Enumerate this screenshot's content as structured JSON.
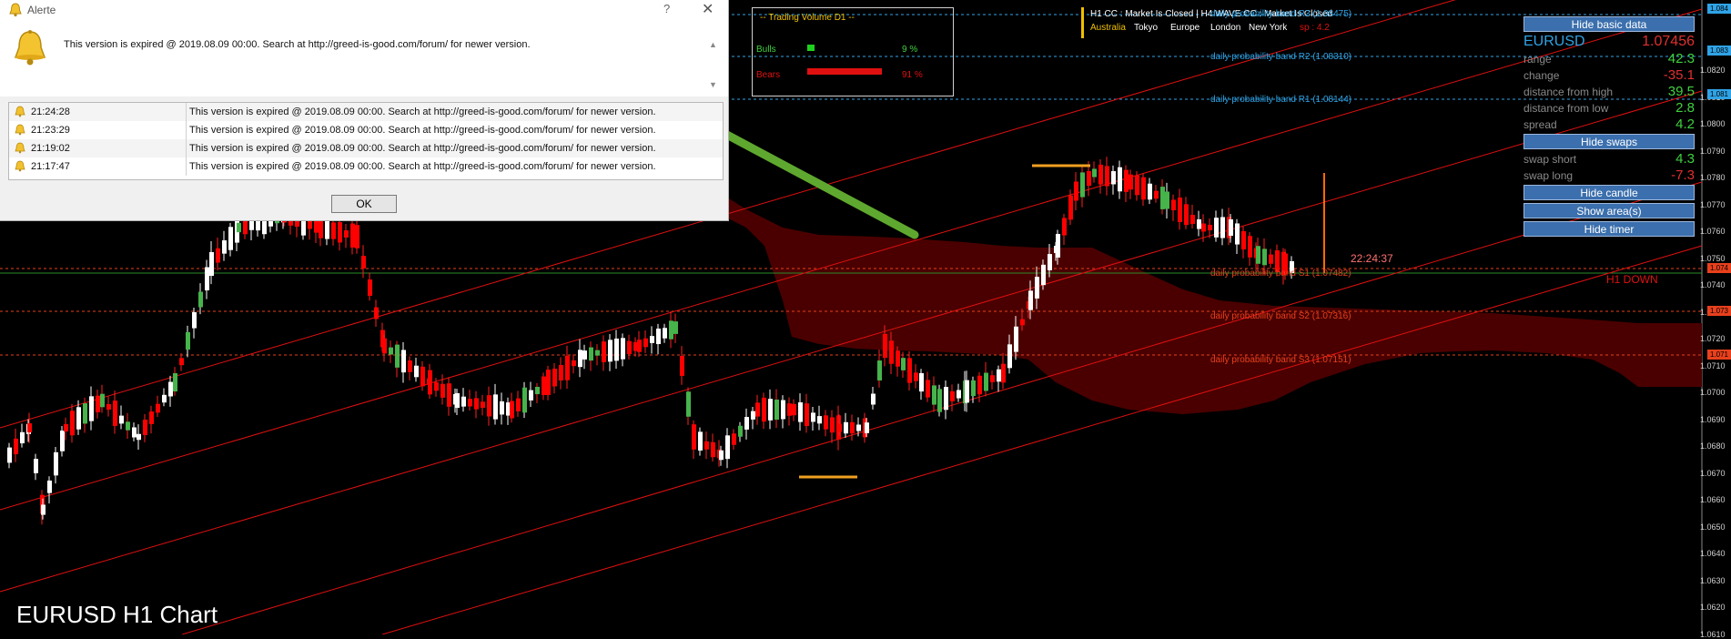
{
  "chart": {
    "title": "EURUSD H1 Chart",
    "timer": "22:24:37",
    "signal": "H1 DOWN"
  },
  "session_bar": {
    "status": "H1 CC : Market Is Closed  |  H4 WAVE CC : Market Is Closed",
    "cities": [
      "Australia",
      "Tokyo",
      "Europe",
      "London",
      "New York"
    ],
    "spread_label": "sp : 4.2"
  },
  "probability_bands": {
    "r3": "daily probability band R3 (1.08475)",
    "r2": "daily probability band R2 (1.08310)",
    "r1": "daily probability band R1 (1.08144)",
    "s1": "daily probability band S1 (1.07482)",
    "s2": "daily probability band S2 (1.07316)",
    "s3": "daily probability band S3 (1.07151)"
  },
  "volume_panel": {
    "title": "-- Trading Volume D1 --",
    "bulls_label": "Bulls",
    "bulls_value": "9 %",
    "bulls_pct": 9,
    "bears_label": "Bears",
    "bears_value": "91 %",
    "bears_pct": 91
  },
  "side_panel": {
    "hide_basic_data": "Hide basic data",
    "symbol": "EURUSD",
    "price": "1.07456",
    "range_label": "range",
    "range_value": "42.3",
    "change_label": "change",
    "change_value": "-35.1",
    "dist_high_label": "distance from high",
    "dist_high_value": "39.5",
    "dist_low_label": "distance from low",
    "dist_low_value": "2.8",
    "spread_label": "spread",
    "spread_value": "4.2",
    "hide_swaps": "Hide swaps",
    "swap_short_label": "swap short",
    "swap_short_value": "4.3",
    "swap_long_label": "swap long",
    "swap_long_value": "-7.3",
    "hide_candle": "Hide candle",
    "show_areas": "Show area(s)",
    "hide_timer": "Hide timer"
  },
  "price_axis": {
    "labels": [
      "1.0820",
      "1.0810",
      "1.0800",
      "1.0790",
      "1.0780",
      "1.0770",
      "1.0760",
      "1.0750",
      "1.0740",
      "1.0730",
      "1.0720",
      "1.0710",
      "1.0700",
      "1.0690",
      "1.0680",
      "1.0670",
      "1.0660",
      "1.0650",
      "1.0640",
      "1.0630",
      "1.0620",
      "1.0610"
    ],
    "tags": [
      "1.084",
      "1.083",
      "1.081",
      "1.074",
      "1.073",
      "1.071"
    ]
  },
  "dialog": {
    "title": "Alerte",
    "help": "?",
    "close": "✕",
    "message": "This version is expired @ 2019.08.09 00:00. Search at http://greed-is-good.com/forum/ for newer version.",
    "rows": [
      {
        "time": "21:24:28",
        "text": "This version is expired @ 2019.08.09 00:00. Search at http://greed-is-good.com/forum/ for newer version."
      },
      {
        "time": "21:23:29",
        "text": "This version is expired @ 2019.08.09 00:00. Search at http://greed-is-good.com/forum/ for newer version."
      },
      {
        "time": "21:19:02",
        "text": "This version is expired @ 2019.08.09 00:00. Search at http://greed-is-good.com/forum/ for newer version."
      },
      {
        "time": "21:17:47",
        "text": "This version is expired @ 2019.08.09 00:00. Search at http://greed-is-good.com/forum/ for newer version."
      }
    ],
    "ok": "OK"
  },
  "colors": {
    "bull_candle": "#ffffff",
    "bear_candle": "#ff0000",
    "cloud": "#4a0000",
    "channel": "#e01010",
    "arrow": "#5fa82f",
    "button": "#3b6fad"
  }
}
